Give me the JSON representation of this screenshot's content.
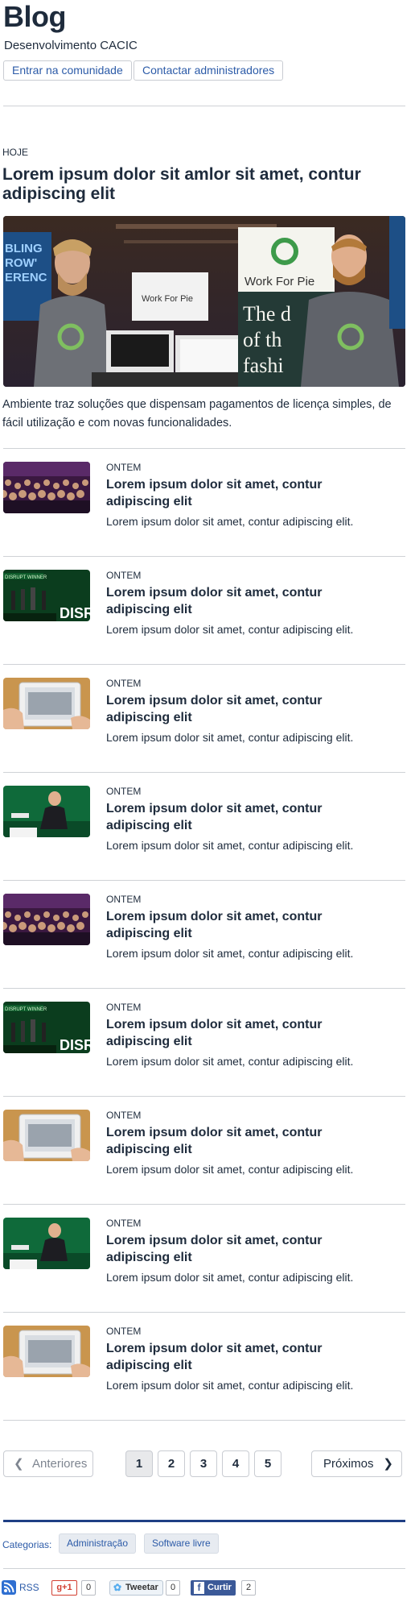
{
  "header": {
    "title": "Blog",
    "subtitle": "Desenvolvimento CACIC",
    "join_label": "Entrar na comunidade",
    "contact_label": "Contactar administradores"
  },
  "featured": {
    "date": "HOJE",
    "title": "Lorem ipsum dolor sit amlor sit amet, contur adipiscing elit",
    "image_text": {
      "banner_left": "BLING\nROW'\nERENC",
      "sign_top": "Work For Pie",
      "banner_right": "Work For Pie",
      "banner_right_sub": "The d\nof th\nfashi"
    },
    "description": "Ambiente traz soluções que dispensam pagamentos de licença simples, de fácil utilização e com novas funcionalidades."
  },
  "posts": [
    {
      "date": "ONTEM",
      "title": "Lorem ipsum dolor sit amet, contur adipiscing elit",
      "excerpt": "Lorem ipsum dolor sit amet, contur adipiscing elit.",
      "thumb": "audience"
    },
    {
      "date": "ONTEM",
      "title": "Lorem ipsum dolor sit amet, contur adipiscing elit",
      "excerpt": "Lorem ipsum dolor sit amet, contur adipiscing elit.",
      "thumb": "stage"
    },
    {
      "date": "ONTEM",
      "title": "Lorem ipsum dolor sit amet, contur adipiscing elit",
      "excerpt": "Lorem ipsum dolor sit amet, contur adipiscing elit.",
      "thumb": "tablet"
    },
    {
      "date": "ONTEM",
      "title": "Lorem ipsum dolor sit amet, contur adipiscing elit",
      "excerpt": "Lorem ipsum dolor sit amet, contur adipiscing elit.",
      "thumb": "speaker"
    },
    {
      "date": "ONTEM",
      "title": "Lorem ipsum dolor sit amet, contur adipiscing elit",
      "excerpt": "Lorem ipsum dolor sit amet, contur adipiscing elit.",
      "thumb": "audience"
    },
    {
      "date": "ONTEM",
      "title": "Lorem ipsum dolor sit amet, contur adipiscing elit",
      "excerpt": "Lorem ipsum dolor sit amet, contur adipiscing elit.",
      "thumb": "stage"
    },
    {
      "date": "ONTEM",
      "title": "Lorem ipsum dolor sit amet, contur adipiscing elit",
      "excerpt": "Lorem ipsum dolor sit amet, contur adipiscing elit.",
      "thumb": "tablet"
    },
    {
      "date": "ONTEM",
      "title": "Lorem ipsum dolor sit amet, contur adipiscing elit",
      "excerpt": "Lorem ipsum dolor sit amet, contur adipiscing elit.",
      "thumb": "speaker"
    },
    {
      "date": "ONTEM",
      "title": "Lorem ipsum dolor sit amet, contur adipiscing elit",
      "excerpt": "Lorem ipsum dolor sit amet, contur adipiscing elit.",
      "thumb": "tablet"
    }
  ],
  "thumb_text": {
    "stage_banner": "DISRUPT WINNER",
    "stage_logo": "DISR"
  },
  "pagination": {
    "prev_label": "Anteriores",
    "next_label": "Próximos",
    "pages": [
      "1",
      "2",
      "3",
      "4",
      "5"
    ],
    "current": "1"
  },
  "footer": {
    "categories_label": "Categorias:",
    "tags": [
      "Administração",
      "Software livre"
    ],
    "rss_label": "RSS",
    "gplus_label": "+1",
    "gplus_count": "0",
    "tweet_label": "Tweetar",
    "tweet_count": "0",
    "like_label": "Curtir",
    "like_count": "2"
  },
  "colors": {
    "text": "#1e2b3c",
    "link": "#2c5ba8",
    "rule": "#1f3f84",
    "rss": "#2f6fd1",
    "gplus": "#d23f31",
    "twitter": "#55acee",
    "facebook": "#3b5998"
  }
}
